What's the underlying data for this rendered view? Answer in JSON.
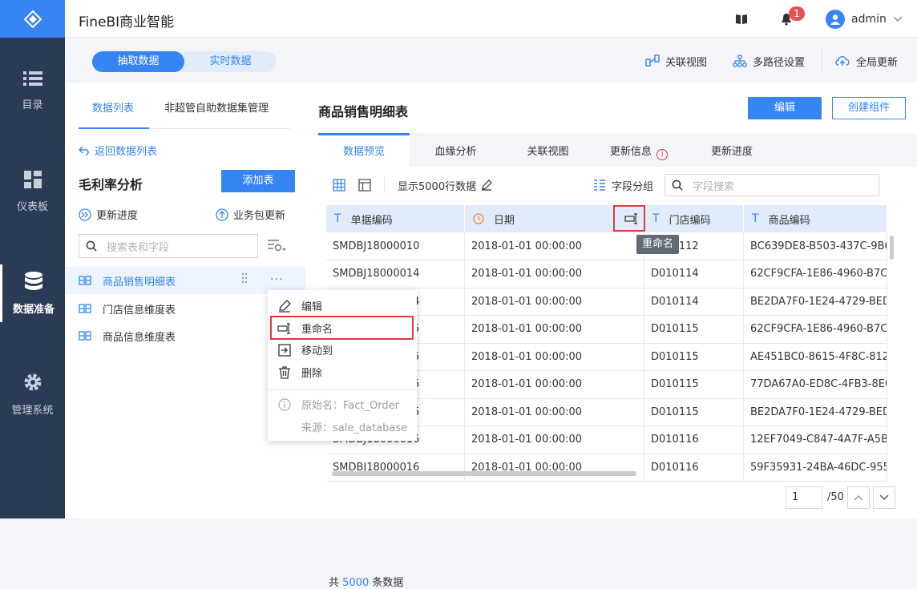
{
  "app": {
    "title": "FineBI商业智能",
    "user": "admin",
    "notification_count": "1",
    "accent": "#3685f2",
    "nav_bg": "#2b3a55"
  },
  "nav": [
    {
      "label": "目录",
      "icon": "list-icon"
    },
    {
      "label": "仪表板",
      "icon": "dashboard-icon"
    },
    {
      "label": "数据准备",
      "icon": "database-icon"
    },
    {
      "label": "管理系统",
      "icon": "gear-icon"
    }
  ],
  "mode": {
    "extract": "抽取数据",
    "realtime": "实时数据"
  },
  "toolbar": {
    "relation_view": "关联视图",
    "multipath": "多路径设置",
    "global_update": "全局更新"
  },
  "left": {
    "tab_list": "数据列表",
    "tab_selfservice": "非超管自助数据集管理",
    "back": "返回数据列表",
    "package": "毛利率分析",
    "add_table": "添加表",
    "update_progress": "更新进度",
    "package_update": "业务包更新",
    "search_placeholder": "搜索表和字段",
    "tables": [
      "商品销售明细表",
      "门店信息维度表",
      "商品信息维度表"
    ]
  },
  "menu": {
    "edit": "编辑",
    "rename": "重命名",
    "move": "移动到",
    "delete": "删除",
    "original": "原始名：Fact_Order",
    "source": "来源：sale_database"
  },
  "detail": {
    "title": "商品销售明细表",
    "edit": "编辑",
    "create": "创建组件",
    "tabs": [
      "数据预览",
      "血缘分析",
      "关联视图",
      "更新信息",
      "更新进度"
    ],
    "show_rows": "显示5000行数据",
    "field_group": "字段分组",
    "field_search": "字段搜索",
    "tooltip": "重命名",
    "columns": [
      "单据编码",
      "日期",
      "门店编码",
      "商品编码"
    ],
    "rows": [
      [
        "SMDBJ18000010",
        "2018-01-01 00:00:00",
        "D010112",
        "BC639DE8-B503-437C-9B6"
      ],
      [
        "SMDBJ18000014",
        "2018-01-01 00:00:00",
        "D010114",
        "62CF9CFA-1E86-4960-B7C"
      ],
      [
        "SMDBJ18000014",
        "2018-01-01 00:00:00",
        "D010114",
        "BE2DA7F0-1E24-4729-BED"
      ],
      [
        "SMDBJ18000015",
        "2018-01-01 00:00:00",
        "D010115",
        "62CF9CFA-1E86-4960-B7C"
      ],
      [
        "SMDBJ18000015",
        "2018-01-01 00:00:00",
        "D010115",
        "AE451BC0-8615-4F8C-812"
      ],
      [
        "SMDBJ18000015",
        "2018-01-01 00:00:00",
        "D010115",
        "77DA67A0-ED8C-4FB3-8E0"
      ],
      [
        "SMDBJ18000015",
        "2018-01-01 00:00:00",
        "D010115",
        "BE2DA7F0-1E24-4729-BED"
      ],
      [
        "SMDBJ18000016",
        "2018-01-01 00:00:00",
        "D010116",
        "12EF7049-C847-4A7F-A5B"
      ],
      [
        "SMDBJ18000016",
        "2018-01-01 00:00:00",
        "D010116",
        "59F35931-24BA-46DC-955"
      ]
    ],
    "footer_total_prefix": "共",
    "footer_total": "5000",
    "footer_total_suffix": "条数据",
    "page": "1",
    "page_total": "/50"
  }
}
